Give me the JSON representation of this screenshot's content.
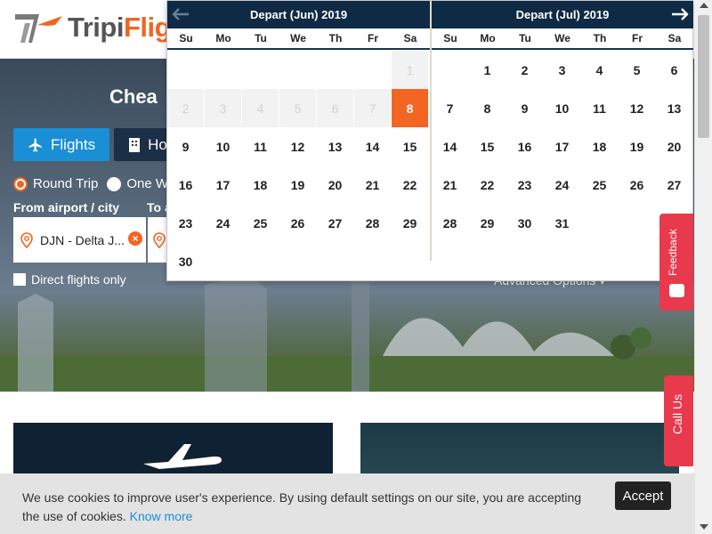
{
  "brand": {
    "name_prefix": "Tripi",
    "name_accent": "Flig"
  },
  "hero": {
    "title": "Chea",
    "tabs": [
      {
        "label": "Flights",
        "icon": "plane-icon",
        "active": true
      },
      {
        "label": "Hote",
        "icon": "building-icon",
        "active": false
      }
    ],
    "trip_types": [
      {
        "label": "Round Trip",
        "checked": true
      },
      {
        "label": "One Wa",
        "checked": false
      }
    ],
    "from_label": "From airport / city",
    "to_label": "To a",
    "from_value": "DJN - Delta J...",
    "direct_label": "Direct flights only",
    "advanced_label": "Advanced Options ▾"
  },
  "datepicker": {
    "months": [
      {
        "title": "Depart (Jun) 2019",
        "weekdays": [
          "Su",
          "Mo",
          "Tu",
          "We",
          "Th",
          "Fr",
          "Sa"
        ],
        "cells": [
          {
            "d": "",
            "s": "empty"
          },
          {
            "d": "",
            "s": "empty"
          },
          {
            "d": "",
            "s": "empty"
          },
          {
            "d": "",
            "s": "empty"
          },
          {
            "d": "",
            "s": "empty"
          },
          {
            "d": "",
            "s": "empty"
          },
          {
            "d": "1",
            "s": "disabled"
          },
          {
            "d": "2",
            "s": "disabled"
          },
          {
            "d": "3",
            "s": "disabled"
          },
          {
            "d": "4",
            "s": "disabled"
          },
          {
            "d": "5",
            "s": "disabled"
          },
          {
            "d": "6",
            "s": "disabled"
          },
          {
            "d": "7",
            "s": "disabled"
          },
          {
            "d": "8",
            "s": "selected"
          },
          {
            "d": "9",
            "s": ""
          },
          {
            "d": "10",
            "s": ""
          },
          {
            "d": "11",
            "s": ""
          },
          {
            "d": "12",
            "s": ""
          },
          {
            "d": "13",
            "s": ""
          },
          {
            "d": "14",
            "s": ""
          },
          {
            "d": "15",
            "s": ""
          },
          {
            "d": "16",
            "s": ""
          },
          {
            "d": "17",
            "s": ""
          },
          {
            "d": "18",
            "s": ""
          },
          {
            "d": "19",
            "s": ""
          },
          {
            "d": "20",
            "s": ""
          },
          {
            "d": "21",
            "s": ""
          },
          {
            "d": "22",
            "s": ""
          },
          {
            "d": "23",
            "s": ""
          },
          {
            "d": "24",
            "s": ""
          },
          {
            "d": "25",
            "s": ""
          },
          {
            "d": "26",
            "s": ""
          },
          {
            "d": "27",
            "s": ""
          },
          {
            "d": "28",
            "s": ""
          },
          {
            "d": "29",
            "s": ""
          },
          {
            "d": "30",
            "s": ""
          }
        ]
      },
      {
        "title": "Depart (Jul) 2019",
        "weekdays": [
          "Su",
          "Mo",
          "Tu",
          "We",
          "Th",
          "Fr",
          "Sa"
        ],
        "cells": [
          {
            "d": "",
            "s": "empty"
          },
          {
            "d": "1",
            "s": ""
          },
          {
            "d": "2",
            "s": ""
          },
          {
            "d": "3",
            "s": ""
          },
          {
            "d": "4",
            "s": ""
          },
          {
            "d": "5",
            "s": ""
          },
          {
            "d": "6",
            "s": ""
          },
          {
            "d": "7",
            "s": ""
          },
          {
            "d": "8",
            "s": ""
          },
          {
            "d": "9",
            "s": ""
          },
          {
            "d": "10",
            "s": ""
          },
          {
            "d": "11",
            "s": ""
          },
          {
            "d": "12",
            "s": ""
          },
          {
            "d": "13",
            "s": ""
          },
          {
            "d": "14",
            "s": ""
          },
          {
            "d": "15",
            "s": ""
          },
          {
            "d": "16",
            "s": ""
          },
          {
            "d": "17",
            "s": ""
          },
          {
            "d": "18",
            "s": ""
          },
          {
            "d": "19",
            "s": ""
          },
          {
            "d": "20",
            "s": ""
          },
          {
            "d": "21",
            "s": ""
          },
          {
            "d": "22",
            "s": ""
          },
          {
            "d": "23",
            "s": ""
          },
          {
            "d": "24",
            "s": ""
          },
          {
            "d": "25",
            "s": ""
          },
          {
            "d": "26",
            "s": ""
          },
          {
            "d": "27",
            "s": ""
          },
          {
            "d": "28",
            "s": ""
          },
          {
            "d": "29",
            "s": ""
          },
          {
            "d": "30",
            "s": ""
          },
          {
            "d": "31",
            "s": ""
          }
        ]
      }
    ]
  },
  "side_buttons": {
    "feedback": "Feedback",
    "call_us": "Call Us"
  },
  "cookie": {
    "text": "We use cookies to improve user's experience. By using default settings on our site, you are accepting the use of cookies.",
    "link": "Know more",
    "accept": "Accept"
  },
  "colors": {
    "accent": "#f26522",
    "primary": "#1a8fd6",
    "navy": "#0e2a45",
    "alert": "#e8394d"
  }
}
